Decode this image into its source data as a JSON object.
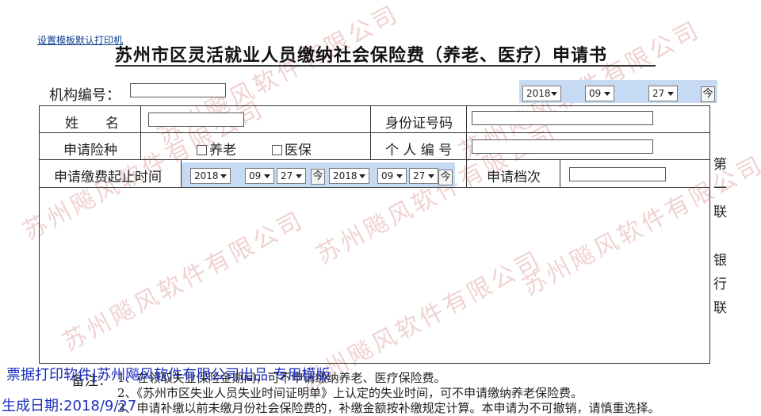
{
  "top_link": "设置模板默认打印机",
  "title": "苏州市区灵活就业人员缴纳社会保险费（养老、医疗）申请书",
  "watermark": "苏州飚风软件有限公司",
  "org_label": "机构编号：",
  "org_value": "",
  "header_date": {
    "year": "2018",
    "month": "09",
    "day": "27",
    "swap": "今"
  },
  "fields": {
    "name_label": "姓　　名",
    "name_value": "",
    "idcard_label": "身份证号码",
    "idcard_value": "",
    "insurance_label": "申请险种",
    "pension": "养老",
    "medical": "医保",
    "personal_no_label": "个 人 编 号",
    "personal_no_value": "",
    "period_label": "申请缴费起止时间",
    "level_label": "申请档次",
    "level_value": ""
  },
  "period_start": {
    "year": "2018",
    "month": "09",
    "day": "27",
    "swap": "今"
  },
  "period_end": {
    "year": "2018",
    "month": "09",
    "day": "27",
    "swap": "今"
  },
  "side": {
    "c1": "第",
    "c2": "一",
    "c3": "联",
    "c4": "银",
    "c5": "行",
    "c6": "联"
  },
  "notes": {
    "label": "备注：",
    "line1": "1、在领取失业保险金期间，可不申请缴纳养老、医疗保险费。",
    "line2": "2、《苏州市区失业人员失业时间证明单》上认定的失业时间，可不申请缴纳养老保险费。",
    "line3": "3、申请补缴以前未缴月份社会保险费的，补缴金额按补缴规定计算。本申请为不可撤销，请慎重选择。"
  },
  "overlay": {
    "line1": "票据打印软件|苏州飚风软件有限公司出品-专用模版",
    "line2": "生成日期:2018/9/27"
  }
}
